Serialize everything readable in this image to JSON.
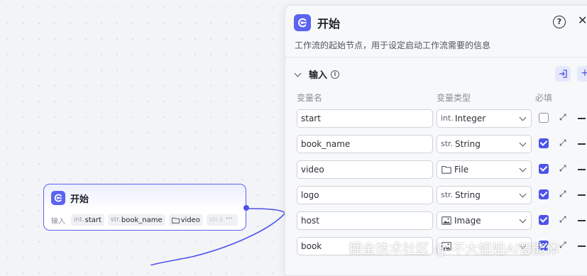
{
  "node": {
    "title": "开始",
    "input_label": "输入",
    "variables": [
      {
        "type": "int.",
        "name": "start"
      },
      {
        "type": "str.",
        "name": "book_name"
      },
      {
        "type": "folder-icon",
        "name": "video"
      },
      {
        "type": "str.",
        "name": "logo"
      }
    ],
    "more_label": "···"
  },
  "panel": {
    "title": "开始",
    "help_label": "?",
    "close_label": "✕",
    "description": "工作流的起始节点，用于设定启动工作流需要的信息",
    "section_title": "输入",
    "info_label": "i",
    "columns": {
      "name": "变量名",
      "type": "变量类型",
      "required": "必填"
    },
    "rows": [
      {
        "name": "start",
        "type_prefix": "int.",
        "type_label": "Integer",
        "type_icon": "",
        "required": false
      },
      {
        "name": "book_name",
        "type_prefix": "str.",
        "type_label": "String",
        "type_icon": "",
        "required": true
      },
      {
        "name": "video",
        "type_prefix": "",
        "type_label": "File",
        "type_icon": "folder-icon",
        "required": true
      },
      {
        "name": "logo",
        "type_prefix": "str.",
        "type_label": "String",
        "type_icon": "",
        "required": true
      },
      {
        "name": "host",
        "type_prefix": "",
        "type_label": "Image",
        "type_icon": "image-icon",
        "required": true
      },
      {
        "name": "book",
        "type_prefix": "",
        "type_label": "",
        "type_icon": "image-icon",
        "required": true
      }
    ]
  },
  "watermark": "掘金技术社区 @ 不大姐姐AI智能体",
  "colors": {
    "accent": "#4d53e8",
    "node_border": "#5b63f0"
  }
}
